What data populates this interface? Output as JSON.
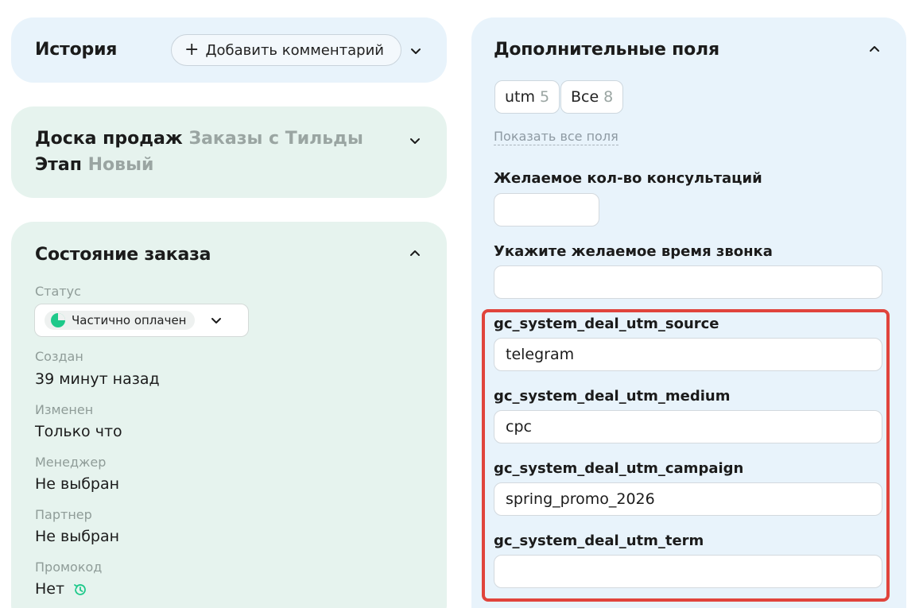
{
  "history": {
    "title": "История",
    "add_comment_label": "Добавить комментарий"
  },
  "board": {
    "board_label": "Доска продаж",
    "board_value": "Заказы с Тильды",
    "stage_label": "Этап",
    "stage_value": "Новый"
  },
  "order_state": {
    "title": "Состояние заказа",
    "status_label": "Статус",
    "status_value": "Частично оплачен",
    "status_color": "#1ec98a",
    "created_label": "Создан",
    "created_value": "39 минут назад",
    "modified_label": "Изменен",
    "modified_value": "Только что",
    "manager_label": "Менеджер",
    "manager_value": "Не выбран",
    "partner_label": "Партнер",
    "partner_value": "Не выбран",
    "promo_label": "Промокод",
    "promo_value": "Нет"
  },
  "extra_fields": {
    "title": "Дополнительные поля",
    "chips": [
      {
        "label": "utm",
        "count": "5"
      },
      {
        "label": "Все",
        "count": "8"
      }
    ],
    "show_all_label": "Показать все поля",
    "fields": [
      {
        "label": "Желаемое кол-во консультаций",
        "value": ""
      },
      {
        "label": "Укажите желаемое время звонка",
        "value": ""
      },
      {
        "label": "gc_system_deal_utm_source",
        "value": "telegram"
      },
      {
        "label": "gc_system_deal_utm_medium",
        "value": "cpc"
      },
      {
        "label": "gc_system_deal_utm_campaign",
        "value": "spring_promo_2026"
      },
      {
        "label": "gc_system_deal_utm_term",
        "value": ""
      }
    ],
    "highlight_color": "#e0443c"
  }
}
